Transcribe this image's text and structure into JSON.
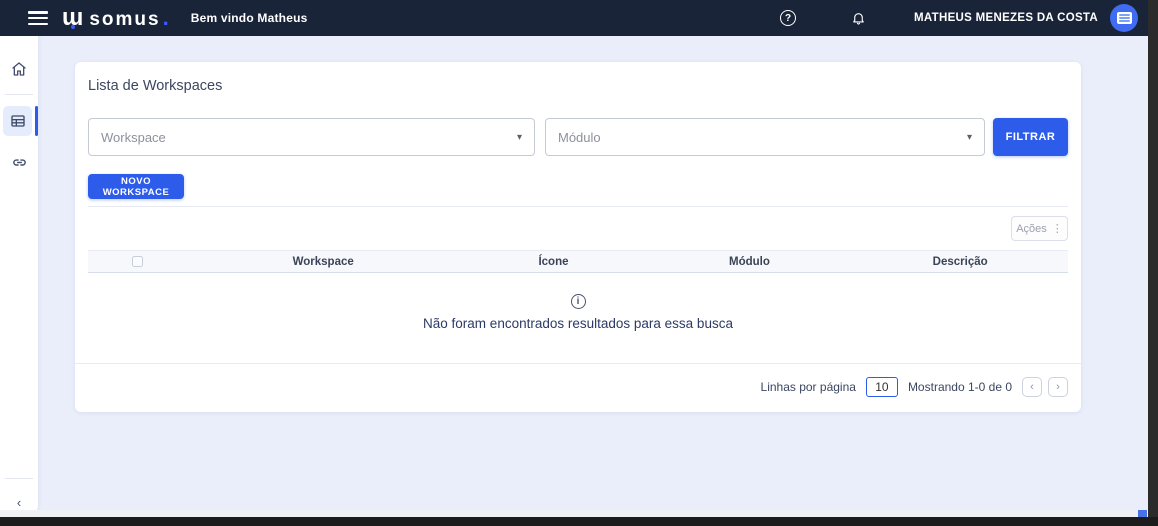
{
  "colors": {
    "accent": "#2d5cea",
    "topbar_bg": "#1a2438",
    "page_bg": "#e9eefa",
    "logo_dot_blue": "#3b5bfd"
  },
  "topbar": {
    "logo_mark": "ɯ",
    "logo_text": "somus",
    "logo_dot": ".",
    "welcome": "Bem vindo Matheus",
    "user_name": "MATHEUS MENEZES DA COSTA",
    "help_glyph": "?"
  },
  "sidebar": {
    "collapse_glyph": "‹"
  },
  "main": {
    "title": "Lista de Workspaces",
    "filters": {
      "workspace_placeholder": "Workspace",
      "modulo_placeholder": "Módulo",
      "caret_glyph": "▾",
      "filter_button": "FILTRAR"
    },
    "new_workspace_button": "NOVO WORKSPACE",
    "actions_button": "Ações",
    "kebab_glyph": "⋮",
    "table": {
      "headers": [
        "Workspace",
        "Ícone",
        "Módulo",
        "Descrição"
      ],
      "empty_icon_glyph": "i",
      "empty_message": "Não foram encontrados resultados para essa busca"
    },
    "pagination": {
      "rows_label": "Linhas por página",
      "rows_value": "10",
      "showing": "Mostrando 1-0 de 0",
      "prev_glyph": "‹",
      "next_glyph": "›"
    }
  }
}
